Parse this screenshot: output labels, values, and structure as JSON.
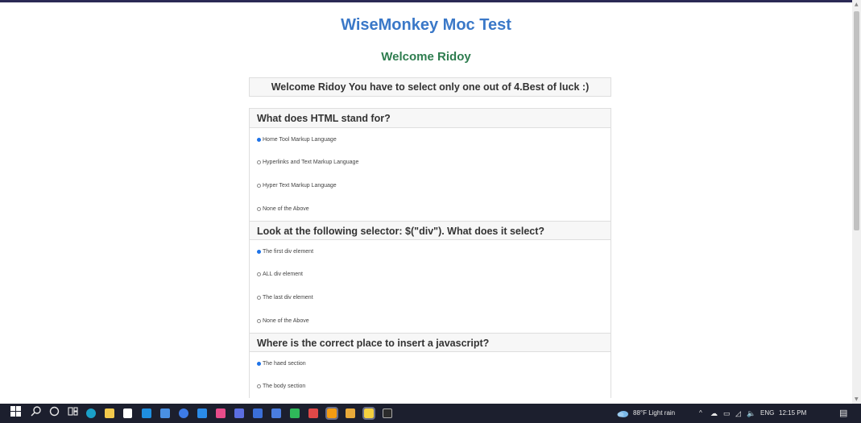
{
  "app_title": "WiseMonkey Moc Test",
  "welcome": "Welcome Ridoy",
  "notice": "Welcome Ridoy You have to select only one out of 4.Best of luck :)",
  "questions": [
    {
      "text": "What does HTML stand for?",
      "options": [
        "Home Tool Markup Language",
        "Hyperlinks and Text Markup Language",
        "Hyper Text Markup Language",
        "None of the Above"
      ],
      "selected": 0
    },
    {
      "text": "Look at the following selector: $(\"div\"). What does it select?",
      "options": [
        "The first div element",
        "ALL div element",
        "The last div element",
        "None of the Above"
      ],
      "selected": 0
    },
    {
      "text": "Where is the correct place to insert a javascript?",
      "options": [
        "The haed section",
        "The body section"
      ],
      "selected": 0
    }
  ],
  "taskbar": {
    "weather": "88°F  Light rain",
    "language": "ENG",
    "time": "12:15 PM"
  },
  "colors": {
    "title": "#3a78c8",
    "welcome": "#2e7d4f",
    "radio_checked": "#1e73e8",
    "taskbar_bg": "#1c1f2e"
  },
  "icons": [
    "windows-start-icon",
    "search-icon",
    "cortana-icon",
    "task-view-icon",
    "edge-icon",
    "file-explorer-icon",
    "store-icon",
    "mail-icon",
    "computer-icon",
    "chrome-icon",
    "vscode-icon",
    "feather-icon",
    "app-icon",
    "app-icon",
    "app-icon",
    "app-icon",
    "app-icon",
    "app-icon",
    "app-icon",
    "app-icon",
    "terminal-icon"
  ]
}
